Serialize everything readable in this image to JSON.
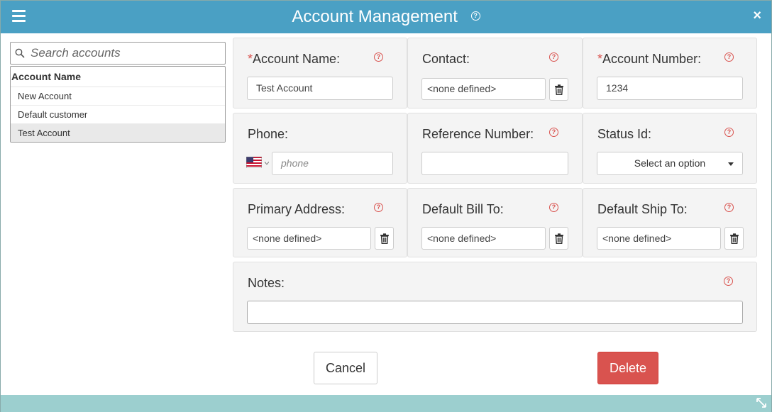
{
  "window": {
    "title": "Account Management",
    "help_glyph": "?",
    "close_glyph": "×"
  },
  "sidebar": {
    "search_placeholder": "Search accounts",
    "list_header": "Account Name",
    "items": [
      {
        "label": "New Account",
        "selected": false
      },
      {
        "label": "Default customer",
        "selected": false
      },
      {
        "label": "Test Account",
        "selected": true
      }
    ]
  },
  "form": {
    "required_mark": "*",
    "help_glyph": "?",
    "account_name": {
      "label": "Account Name:",
      "required": true,
      "value": "Test Account"
    },
    "contact": {
      "label": "Contact:",
      "value": "<none defined>"
    },
    "account_number": {
      "label": "Account Number:",
      "required": true,
      "value": "1234"
    },
    "phone": {
      "label": "Phone:",
      "placeholder": "phone",
      "country": "US"
    },
    "reference_number": {
      "label": "Reference Number:",
      "value": ""
    },
    "status_id": {
      "label": "Status Id:",
      "selected": "Select an option"
    },
    "primary_address": {
      "label": "Primary Address:",
      "value": "<none defined>"
    },
    "default_bill_to": {
      "label": "Default Bill To:",
      "value": "<none defined>"
    },
    "default_ship_to": {
      "label": "Default Ship To:",
      "value": "<none defined>"
    },
    "notes": {
      "label": "Notes:",
      "value": ""
    }
  },
  "actions": {
    "cancel_label": "Cancel",
    "delete_label": "Delete"
  },
  "colors": {
    "titlebar": "#4aa0c4",
    "required": "#d9534f",
    "delete_button": "#d9534f",
    "footer_bar": "#9ccfcf"
  },
  "icons": [
    "hamburger-menu-icon",
    "help-icon",
    "close-icon",
    "search-icon",
    "trash-icon",
    "us-flag-icon",
    "chevron-down-icon",
    "resize-icon"
  ]
}
